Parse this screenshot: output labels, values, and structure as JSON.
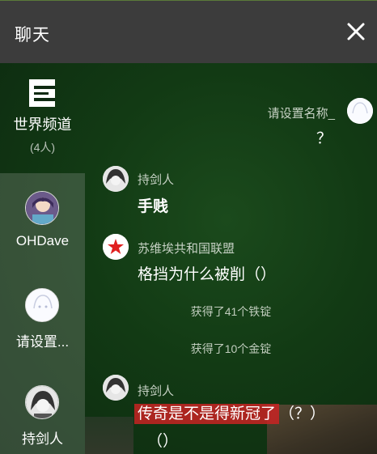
{
  "header": {
    "title": "聊天"
  },
  "sidebar": {
    "world_channel": {
      "label": "世界频道",
      "count": "(4人)"
    },
    "items": [
      {
        "name": "OHDave"
      },
      {
        "name": "请设置..."
      },
      {
        "name": "持剑人"
      }
    ]
  },
  "messages": [
    {
      "sender": "请设置名称_",
      "text": "？"
    },
    {
      "sender": "持剑人",
      "text": "手贱"
    },
    {
      "sender": "苏维埃共和国联盟",
      "text": "格挡为什么被削（）"
    },
    {
      "system": "获得了41个铁锭"
    },
    {
      "system": "获得了10个金锭"
    },
    {
      "sender": "持剑人",
      "text_highlight": "传奇是不是得新冠了",
      "text_rest": "（？）",
      "text_line2": "（）"
    }
  ],
  "colors": {
    "highlight": "#c82323",
    "titlebar": "#3c3c3c",
    "chat_bg": "#123a14"
  }
}
